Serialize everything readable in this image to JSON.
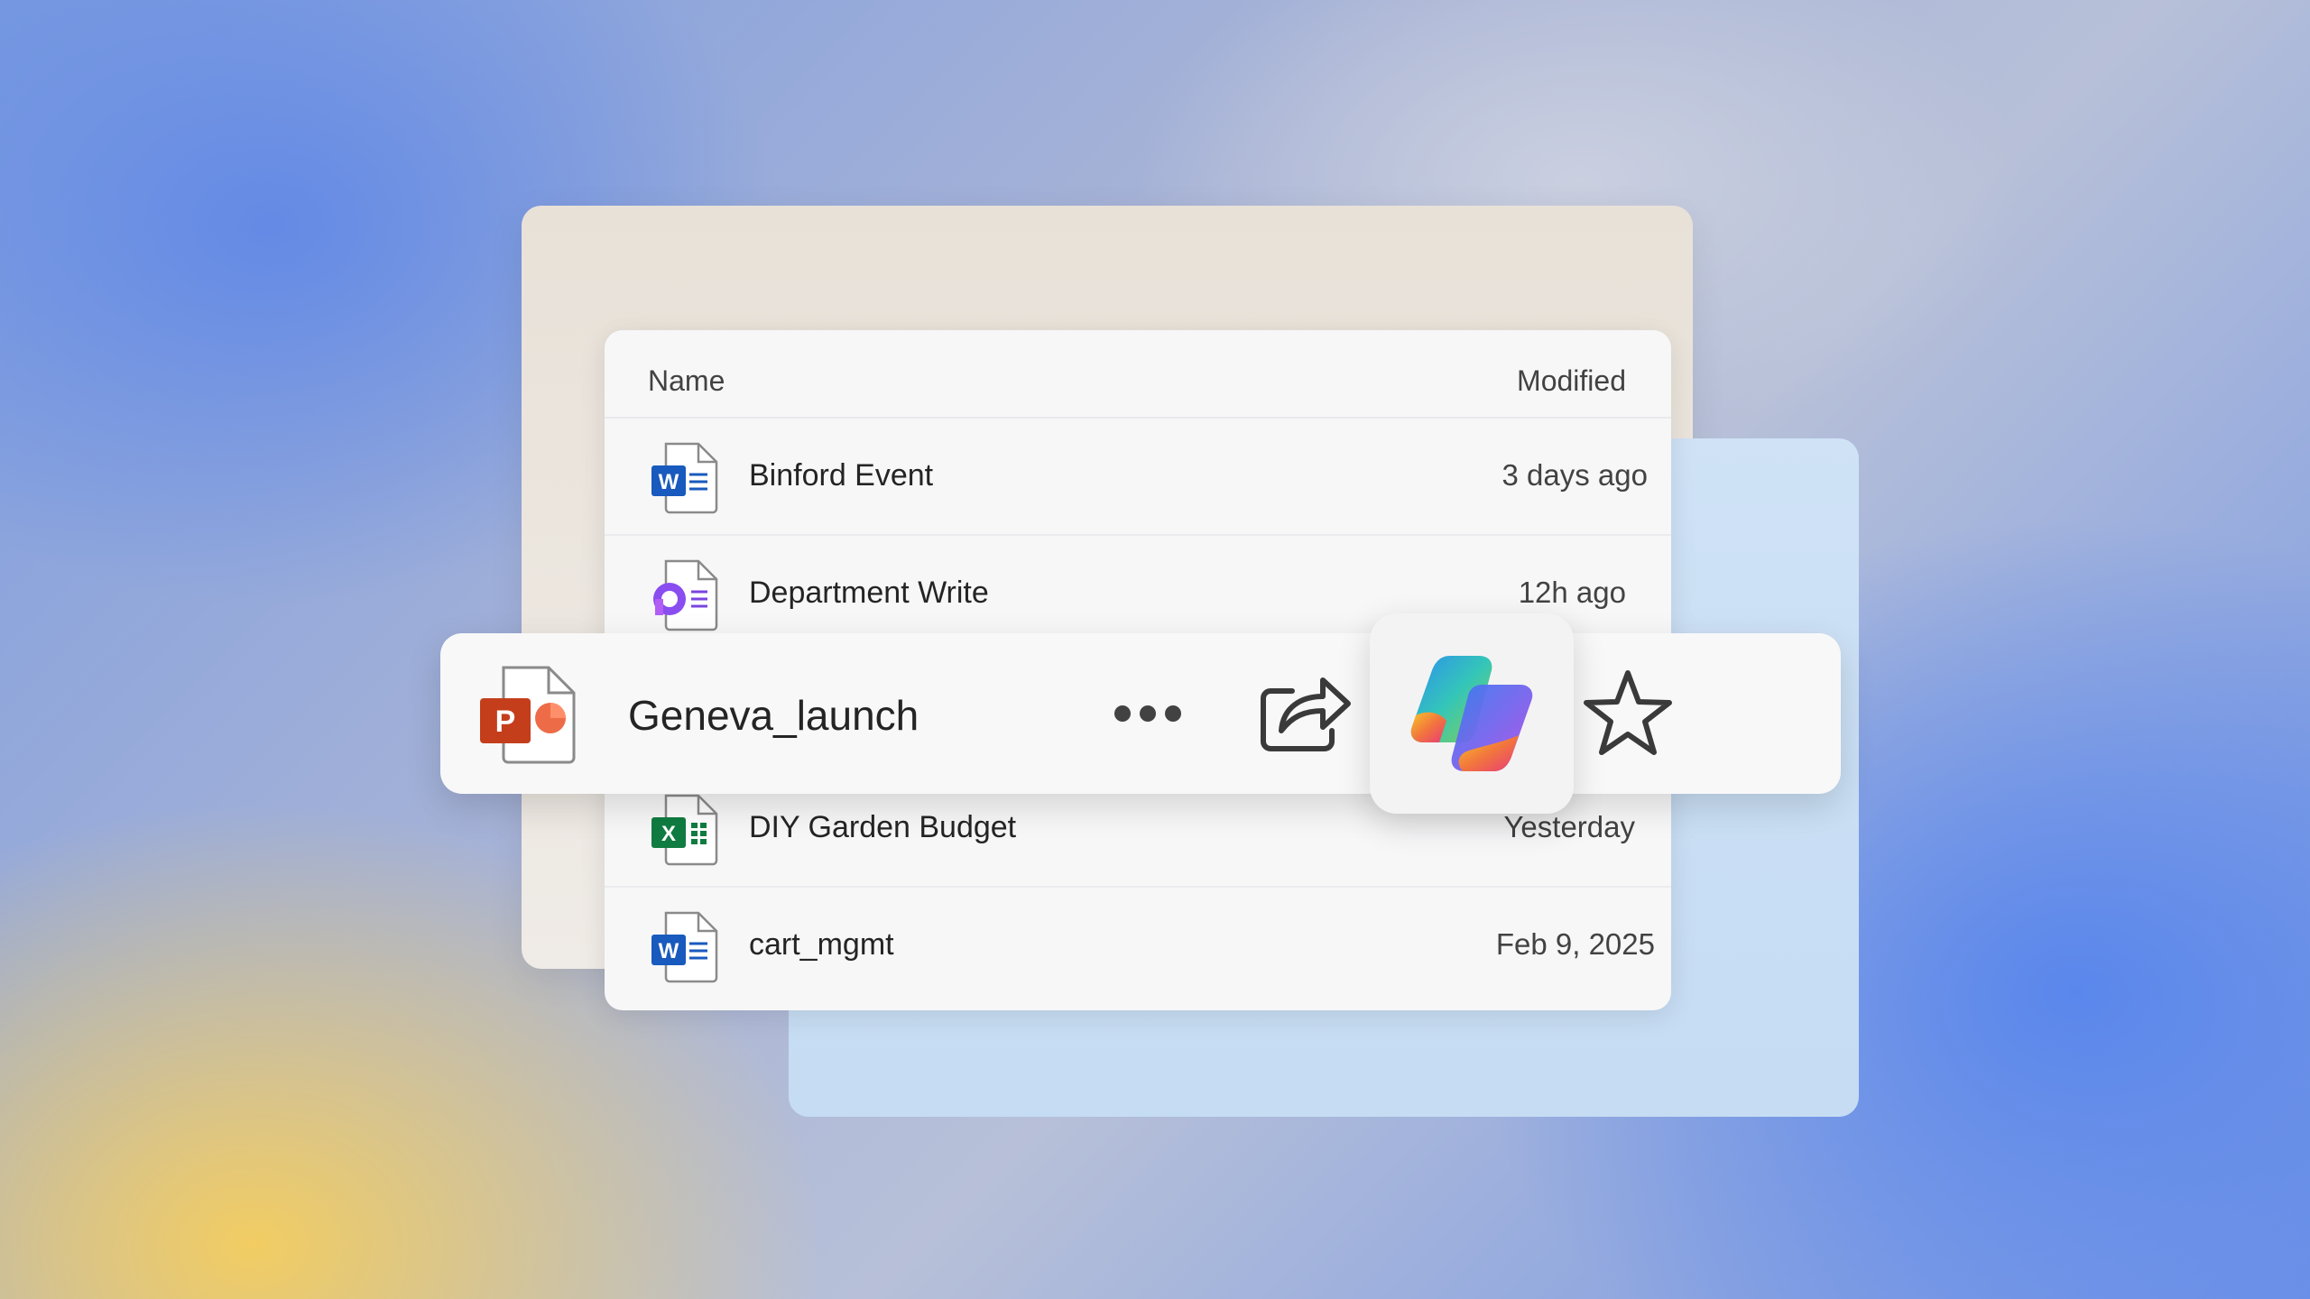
{
  "list": {
    "header": {
      "name": "Name",
      "modified": "Modified"
    },
    "rows": [
      {
        "name": "Binford Event",
        "modified": "3 days ago",
        "icon": "word-icon"
      },
      {
        "name": "Department Write",
        "modified": "12h ago",
        "icon": "loop-icon"
      },
      {
        "name": "DIY Garden Budget",
        "modified": "Yesterday",
        "icon": "excel-icon"
      },
      {
        "name": "cart_mgmt",
        "modified": "Feb 9, 2025",
        "icon": "word-icon"
      }
    ]
  },
  "selected": {
    "name": "Geneva_launch",
    "icon": "powerpoint-icon",
    "actions": [
      "more-icon",
      "share-icon",
      "copilot-icon",
      "star-icon"
    ]
  },
  "colors": {
    "word": "#185abd",
    "excel": "#107c41",
    "powerpoint": "#c43e1c",
    "loop": "#7b44e0"
  }
}
